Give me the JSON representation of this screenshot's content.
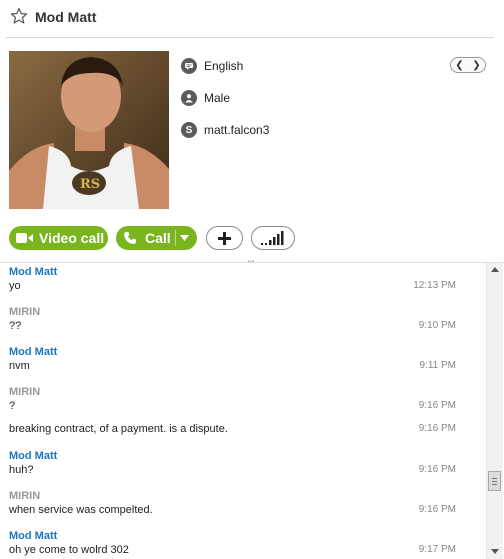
{
  "contact": {
    "name": "Mod Matt",
    "language": "English",
    "gender": "Male",
    "skype_id": "matt.falcon3"
  },
  "actions": {
    "video_call_label": "Video call",
    "call_label": "Call",
    "ellipsis": "..."
  },
  "colors": {
    "accent_green": "#7ab51d",
    "sender_me": "#1b78b8",
    "sender_them": "#9a9a9a"
  },
  "messages": [
    {
      "sender": "Mod Matt",
      "text": "yo",
      "time": "12:13 PM"
    },
    {
      "sender": "MIRIN",
      "text": "??",
      "time": "9:10 PM"
    },
    {
      "sender": "Mod Matt",
      "text": "nvm",
      "time": "9:11 PM"
    },
    {
      "sender": "MIRIN",
      "text": "?",
      "time": "9:16 PM"
    },
    {
      "sender": "",
      "text": "breaking contract, of a payment. is a dispute.",
      "time": "9:16 PM"
    },
    {
      "sender": "Mod Matt",
      "text": "huh?",
      "time": "9:16 PM"
    },
    {
      "sender": "MIRIN",
      "text": "when service was compelted.",
      "time": "9:16 PM"
    },
    {
      "sender": "Mod Matt",
      "text": "oh ye come to wolrd 302",
      "time": "9:17 PM"
    }
  ]
}
